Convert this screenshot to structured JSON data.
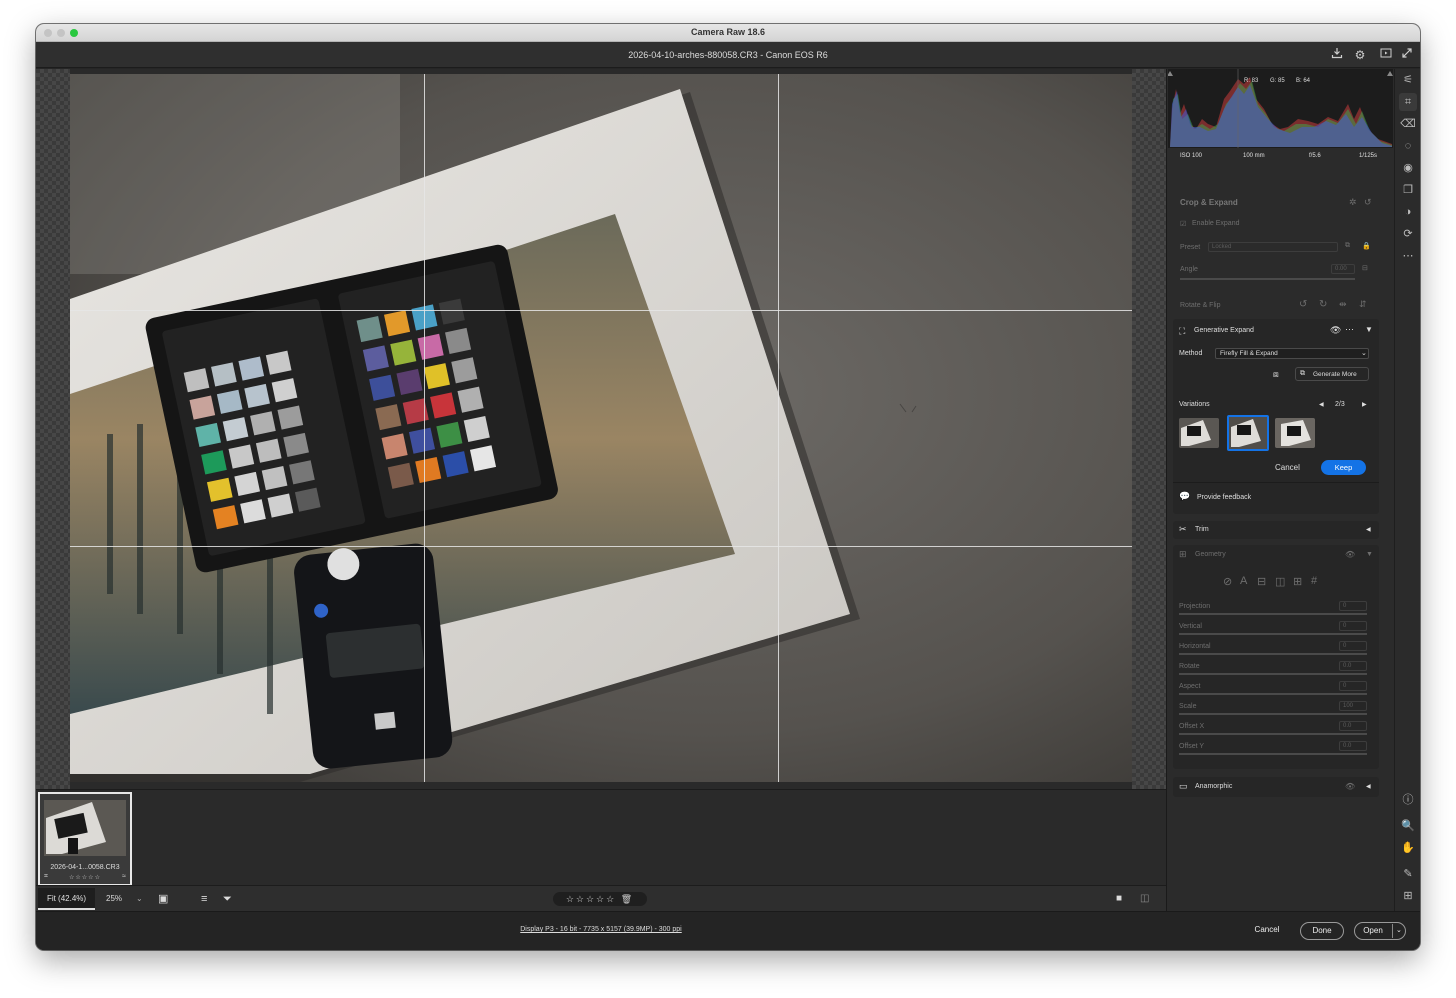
{
  "window": {
    "title": "Camera Raw 18.6"
  },
  "topbar": {
    "file_title": "2026-04-10-arches-880058.CR3  -  Canon EOS R6"
  },
  "histogram": {
    "r": "R: 83",
    "g": "G: 85",
    "b": "B: 64"
  },
  "exif": {
    "iso": "ISO 100",
    "focal": "100 mm",
    "aperture": "f/5.6",
    "shutter": "1/125s"
  },
  "crop": {
    "title": "Crop & Expand",
    "enable_expand": "Enable Expand",
    "preset_label": "Preset",
    "preset_value": "Locked",
    "angle_label": "Angle",
    "angle_value": "0.00",
    "rotate_flip": "Rotate & Flip"
  },
  "genexpand": {
    "title": "Generative Expand",
    "method_label": "Method",
    "method_value": "Firefly Fill & Expand",
    "generate_more": "Generate More",
    "variations_label": "Variations",
    "variations_count": "2/3",
    "cancel": "Cancel",
    "keep": "Keep",
    "feedback": "Provide feedback"
  },
  "trim": {
    "title": "Trim"
  },
  "geometry": {
    "title": "Geometry",
    "sliders": [
      {
        "label": "Projection",
        "value": "0"
      },
      {
        "label": "Vertical",
        "value": "0"
      },
      {
        "label": "Horizontal",
        "value": "0"
      },
      {
        "label": "Rotate",
        "value": "0.0"
      },
      {
        "label": "Aspect",
        "value": "0"
      },
      {
        "label": "Scale",
        "value": "100"
      },
      {
        "label": "Offset X",
        "value": "0.0"
      },
      {
        "label": "Offset Y",
        "value": "0.0"
      }
    ]
  },
  "anamorphic": {
    "title": "Anamorphic"
  },
  "filmstrip": {
    "filename": "2026-04-1...0058.CR3",
    "stars": "☆☆☆☆☆"
  },
  "bottombar": {
    "fit": "Fit (42.4%)",
    "zoom": "25%",
    "stars": "☆☆☆☆☆"
  },
  "status": {
    "info": "Display P3 - 16 bit - 7735 x 5157 (39.9MP) - 300 ppi",
    "cancel": "Cancel",
    "done": "Done",
    "open": "Open"
  },
  "colors": {
    "accent": "#1473e6",
    "panel": "#2b2b2b",
    "background": "#262626"
  }
}
